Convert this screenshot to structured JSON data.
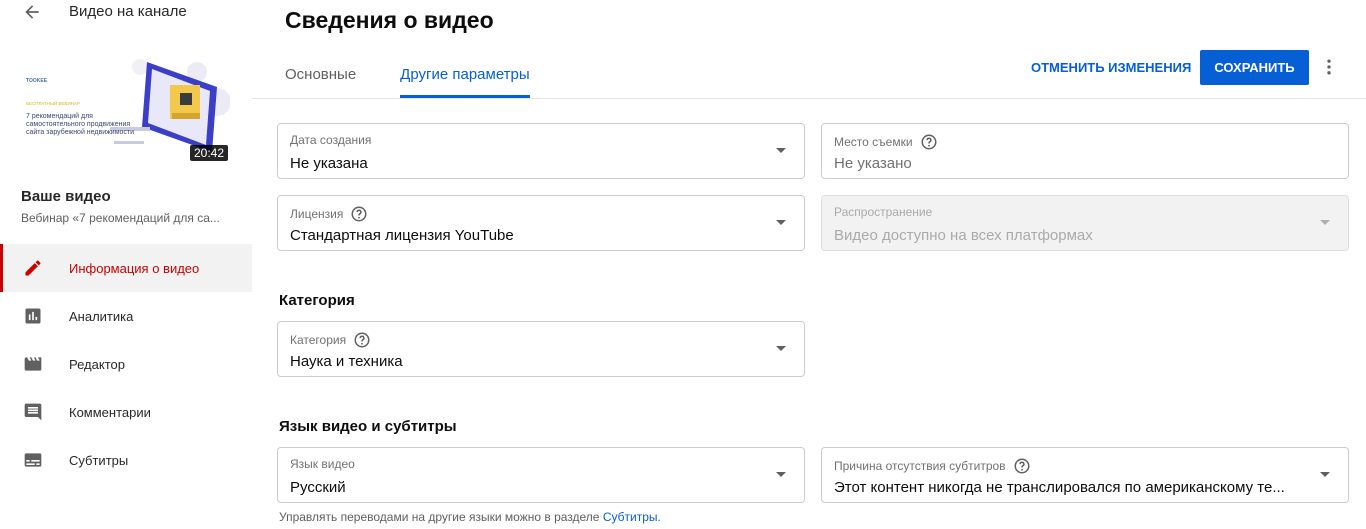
{
  "sidebar": {
    "back_title": "Видео на канале",
    "thumbnail": {
      "logo_text": "TOOKEE",
      "tag_text": "БЕСПЛАТНЫЙ ВЕБИНАР",
      "caption": "7 рекомендаций для самостоятельного продвижения сайта зарубежной недвижимости",
      "duration": "20:42"
    },
    "your_video_label": "Ваше видео",
    "video_title": "Вебинар «7 рекомендаций для са...",
    "nav_items": [
      {
        "label": "Информация о видео",
        "icon": "pencil-icon",
        "active": true
      },
      {
        "label": "Аналитика",
        "icon": "analytics-icon",
        "active": false
      },
      {
        "label": "Редактор",
        "icon": "clapperboard-icon",
        "active": false
      },
      {
        "label": "Комментарии",
        "icon": "comment-icon",
        "active": false
      },
      {
        "label": "Субтитры",
        "icon": "subtitles-icon",
        "active": false
      }
    ]
  },
  "main": {
    "title": "Сведения о видео",
    "tabs": [
      {
        "label": "Основные",
        "active": false
      },
      {
        "label": "Другие параметры",
        "active": true
      }
    ],
    "undo_label": "ОТМЕНИТЬ ИЗМЕНЕНИЯ",
    "save_label": "СОХРАНИТЬ",
    "fields": {
      "recording_date": {
        "label": "Дата создания",
        "value": "Не указана"
      },
      "location": {
        "label": "Место съемки",
        "placeholder": "Не указано"
      },
      "license": {
        "label": "Лицензия",
        "value": "Стандартная лицензия YouTube"
      },
      "distribution": {
        "label": "Распространение",
        "value": "Видео доступно на всех платформах"
      },
      "category": {
        "label": "Категория",
        "value": "Наука и техника"
      },
      "video_language": {
        "label": "Язык видео",
        "value": "Русский"
      },
      "caption_certification": {
        "label": "Причина отсутствия субтитров",
        "value": "Этот контент никогда не транслировался по американскому те..."
      }
    },
    "category_section_title": "Категория",
    "language_section_title": "Язык видео и субтитры",
    "hint_text": "Управлять переводами на другие языки можно в разделе",
    "hint_link": "Субтитры",
    "hint_end": "."
  },
  "colors": {
    "accent": "#065fd4",
    "active_nav": "#cc0000"
  }
}
